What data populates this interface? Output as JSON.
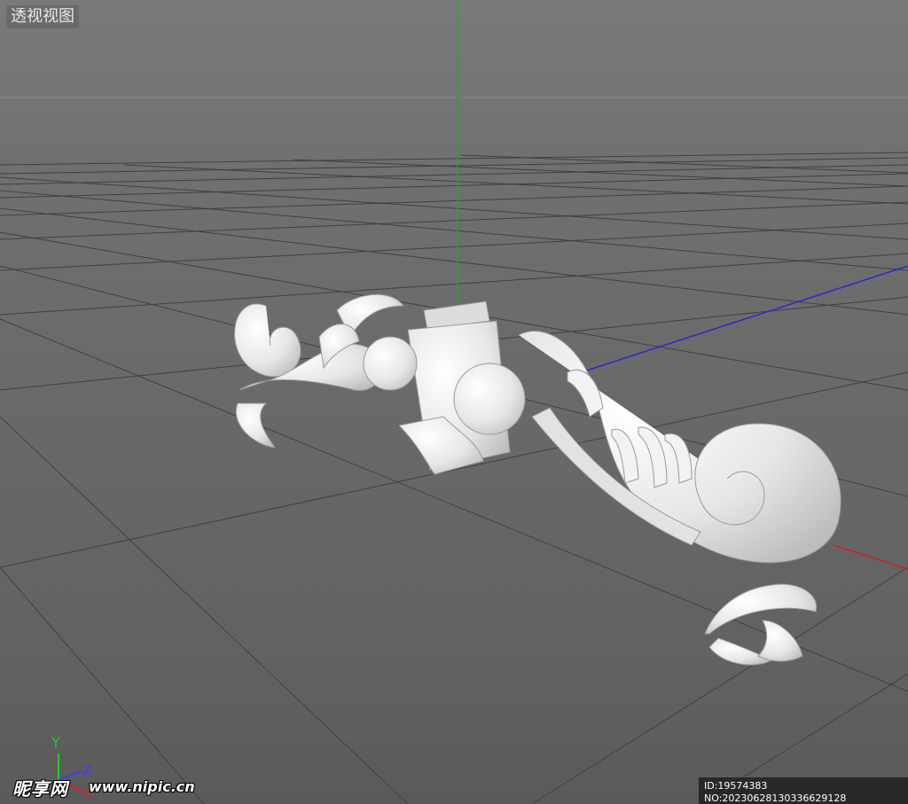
{
  "viewport": {
    "label": "透视视图"
  },
  "axes_widget": {
    "y_label": "Y",
    "z_label": "Z",
    "x_label": "X"
  },
  "watermark": {
    "logo_text": "昵享网",
    "url": "www.nipic.cn",
    "image_id": "ID:19574383 NO:20230628130336629128"
  },
  "colors": {
    "y_axis": "#22aa22",
    "x_axis": "#cc2222",
    "z_axis": "#2a2ad0",
    "model": "#e9e9e9"
  },
  "icons": [
    "axis-gizmo-icon"
  ]
}
